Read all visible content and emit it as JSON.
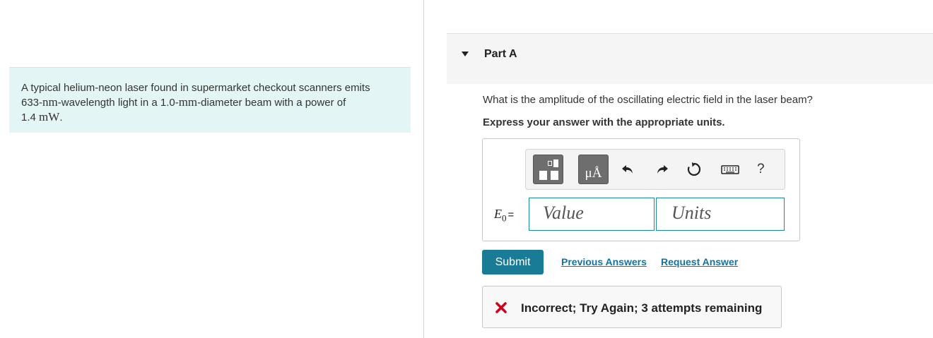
{
  "problem": {
    "line1": "A typical helium-neon laser found in supermarket checkout scanners emits",
    "line2_num": "633-",
    "line2_unit": "nm",
    "line2_mid": "-wavelength light in a 1.0-",
    "line2_unit2": "mm",
    "line2_end": "-diameter beam with a power of",
    "line3_num": "1.4 ",
    "line3_unit": "mW",
    "line3_end": "."
  },
  "part": {
    "title": "Part A",
    "question": "What is the amplitude of the oscillating electric field in the laser beam?",
    "instruction": "Express your answer with the appropriate units."
  },
  "toolbar": {
    "units_label": "μÅ",
    "help_label": "?",
    "icons": [
      "templates-icon",
      "units-icon",
      "undo-icon",
      "redo-icon",
      "reset-icon",
      "keyboard-icon",
      "help-icon"
    ]
  },
  "answer": {
    "symbol": "E",
    "subscript": "0",
    "equals": "=",
    "value_placeholder": "Value",
    "units_placeholder": "Units"
  },
  "actions": {
    "submit_label": "Submit",
    "previous_answers_label": "Previous Answers",
    "request_answer_label": "Request Answer"
  },
  "feedback": {
    "text": "Incorrect; Try Again; 3 attempts remaining",
    "status_color": "#d0021b"
  },
  "colors": {
    "accent": "#1a7b96",
    "link": "#0f75a8",
    "problem_bg": "#e4f5f5"
  }
}
